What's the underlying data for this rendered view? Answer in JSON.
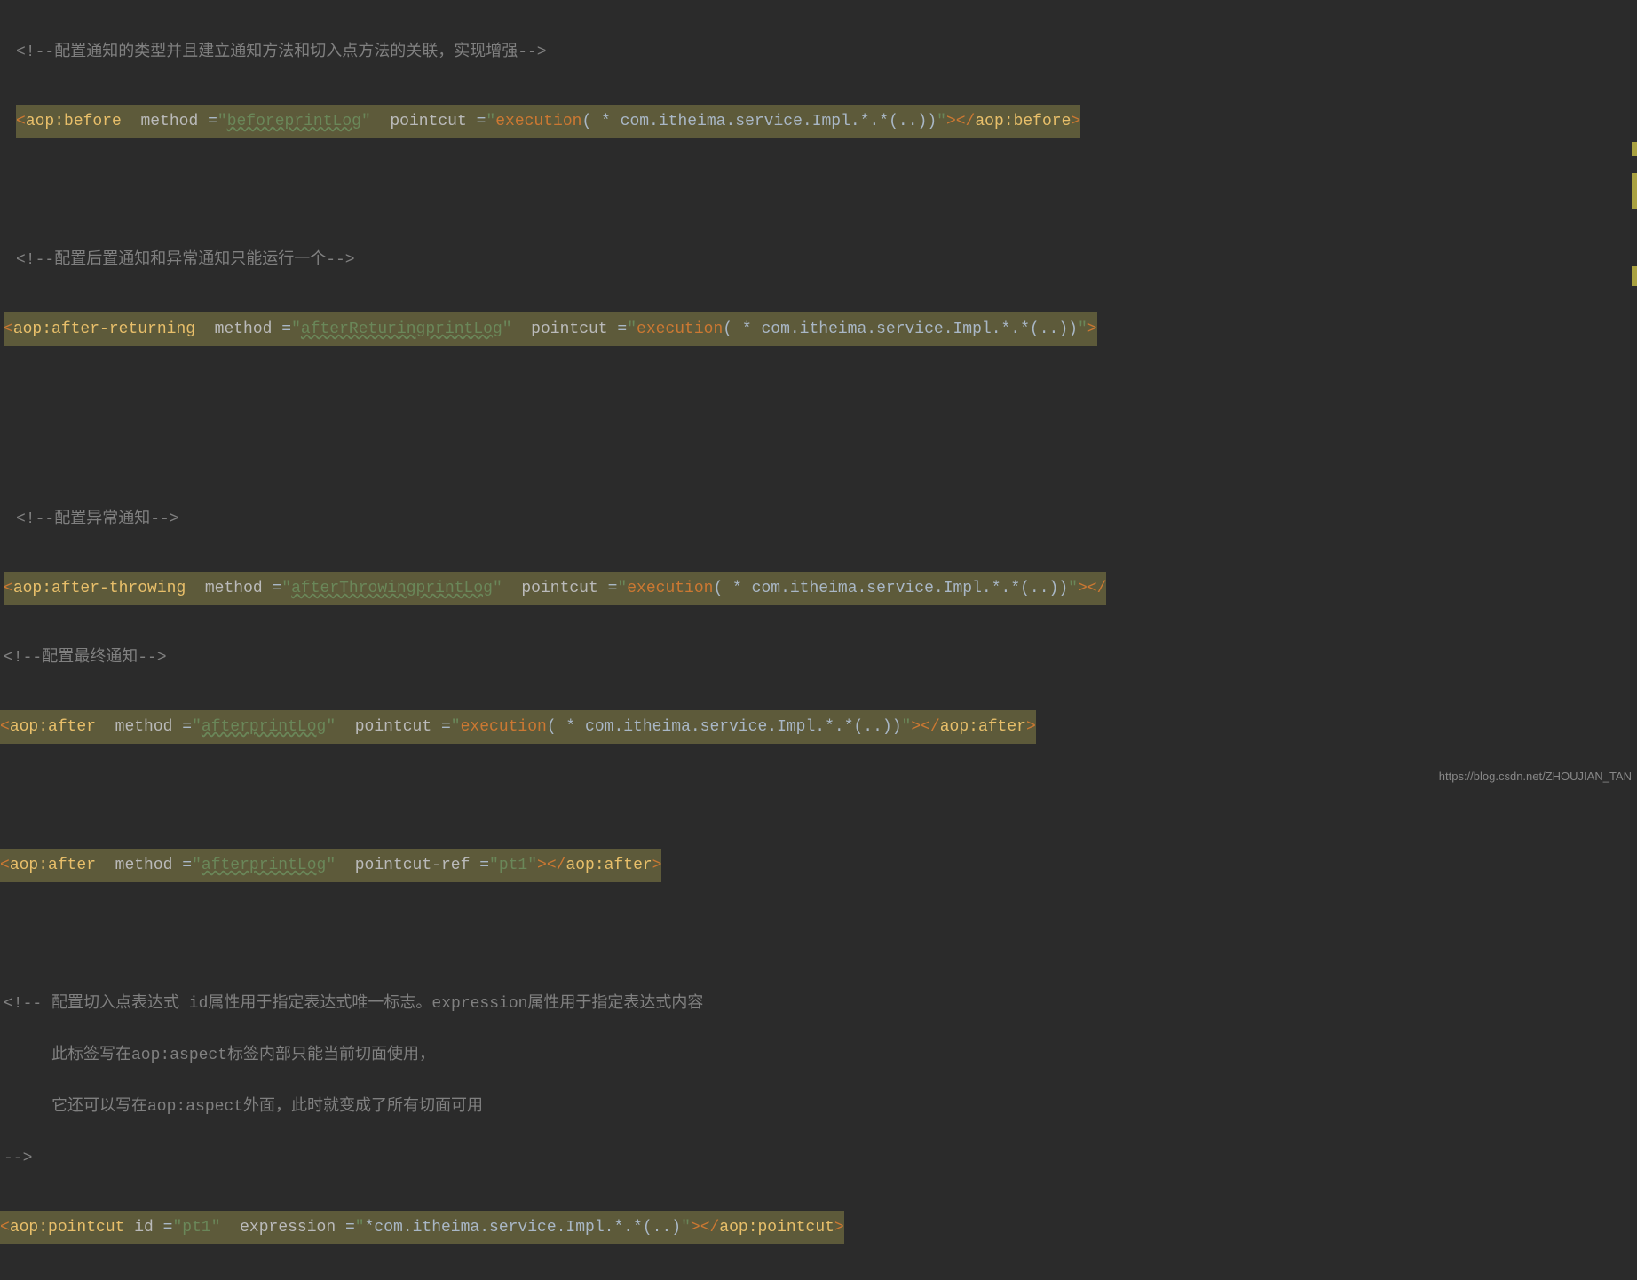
{
  "comments": {
    "c1": "<!--配置通知的类型并且建立通知方法和切入点方法的关联，实现增强-->",
    "c2": "<!--配置后置通知和异常通知只能运行一个-->",
    "c3": "<!--配置异常通知-->",
    "c4": "<!--配置最终通知-->",
    "c5_l1": "<!-- 配置切入点表达式 id属性用于指定表达式唯一标志。expression属性用于指定表达式内容",
    "c5_l2": "     此标签写在aop:aspect标签内部只能当前切面使用，",
    "c5_l3": "     它还可以写在aop:aspect外面，此时就变成了所有切面可用",
    "c5_l4": "-->"
  },
  "tokens": {
    "lt": "<",
    "gt": ">",
    "lt_close": "</",
    "slash_gt": "/>",
    "eq": "=",
    "dq": "\""
  },
  "tags": {
    "before": "aop:before",
    "afterReturning": "aop:after-returning",
    "afterThrowing": "aop:after-throwing",
    "after": "aop:after",
    "pointcut": "aop:pointcut"
  },
  "attrs": {
    "method": "method",
    "pointcut": "pointcut",
    "pointcut_ref": "pointcut-ref",
    "id": "id",
    "expression": "expression"
  },
  "methods": {
    "before": "beforeprintLog",
    "afterReturning": "afterReturingprintLog",
    "afterThrowing": "afterThrowingprintLog",
    "after": "afterprintLog"
  },
  "pointcut": {
    "exec_kw": "execution",
    "expr_paren_open": "( * ",
    "expr_body": "com.itheima.service.Impl.*.*(..))",
    "full_expr": "*com.itheima.service.Impl.*.*(..)",
    "ref": "pt1",
    "id": "pt1"
  },
  "watermark": "https://blog.csdn.net/ZHOUJIAN_TAN"
}
